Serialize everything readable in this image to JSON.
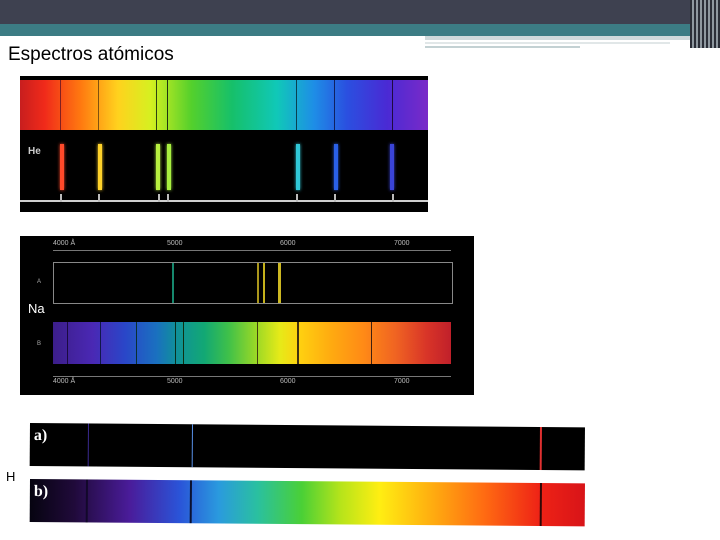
{
  "slide": {
    "title": "Espectros atómicos"
  },
  "helium": {
    "label": "He",
    "line_colors": [
      "#ff4a2a",
      "#ffd22a",
      "#b8f040",
      "#a8f040",
      "#30c8d8",
      "#2a60e8",
      "#3a44d8"
    ]
  },
  "sodium": {
    "label": "Na",
    "scale_top": [
      "4000 Å",
      "5000",
      "6000",
      "7000"
    ],
    "scale_bottom": [
      "4000 Å",
      "5000",
      "6000",
      "7000"
    ],
    "row_a": "A",
    "row_b": "B",
    "emission_line_colors": [
      "#1aa080",
      "#c8b020",
      "#e8d020",
      "#f0d828"
    ]
  },
  "hydrogen": {
    "label": "H",
    "panel_a_label": "a)",
    "panel_b_label": "b)",
    "line_colors": [
      "#5050c8",
      "#5890e8",
      "#e03030"
    ]
  }
}
